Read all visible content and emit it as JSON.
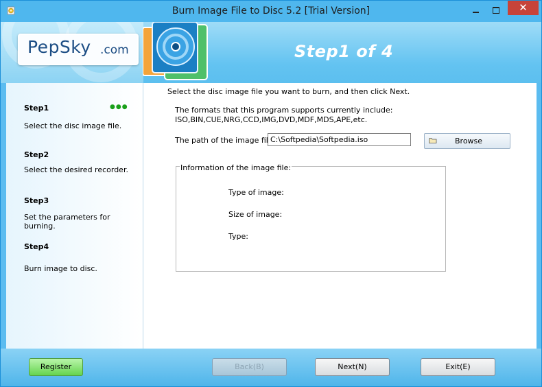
{
  "window": {
    "title": "Burn Image File to Disc 5.2 [Trial Version]",
    "close_glyph": "✕"
  },
  "header": {
    "logo_main": "PepSky",
    "logo_tld": ".com",
    "step_title": "Step1 of 4"
  },
  "sidebar": {
    "current_step_indicator": "●●●",
    "steps": [
      {
        "title": "Step1",
        "description": "Select the disc image file."
      },
      {
        "title": "Step2",
        "description": "Select the desired recorder."
      },
      {
        "title": "Step3",
        "description": "Set the parameters for burning."
      },
      {
        "title": "Step4",
        "description": "Burn image to disc."
      }
    ]
  },
  "main": {
    "instruction": "Select the disc image file you want to burn, and then click Next.",
    "formats_line1": "The formats that this program supports currently include:",
    "formats_line2": "ISO,BIN,CUE,NRG,CCD,IMG,DVD,MDF,MDS,APE,etc.",
    "path_label": "The path of the image file:",
    "path_value": "C:\\Softpedia\\Softpedia.iso",
    "browse_label": "Browse",
    "info": {
      "legend": "Information of the image file:",
      "type_of_image_label": "Type of image:",
      "size_of_image_label": "Size of image:",
      "type_label": "Type:"
    }
  },
  "footer": {
    "register_label": "Register",
    "back_label": "Back(B)",
    "next_label": "Next(N)",
    "exit_label": "Exit(E)"
  },
  "colors": {
    "title_bar": "#4fb7ee",
    "close_button": "#c74339",
    "register_button": "#64d44e",
    "step_indicator": "#1aa01a",
    "step_title_text": "#ffffff"
  },
  "icons": {
    "app": "disc-app-icon",
    "minimize": "minimize-icon",
    "maximize": "maximize-icon",
    "close": "close-icon",
    "product": "disc-product-icon",
    "folder": "folder-icon"
  }
}
